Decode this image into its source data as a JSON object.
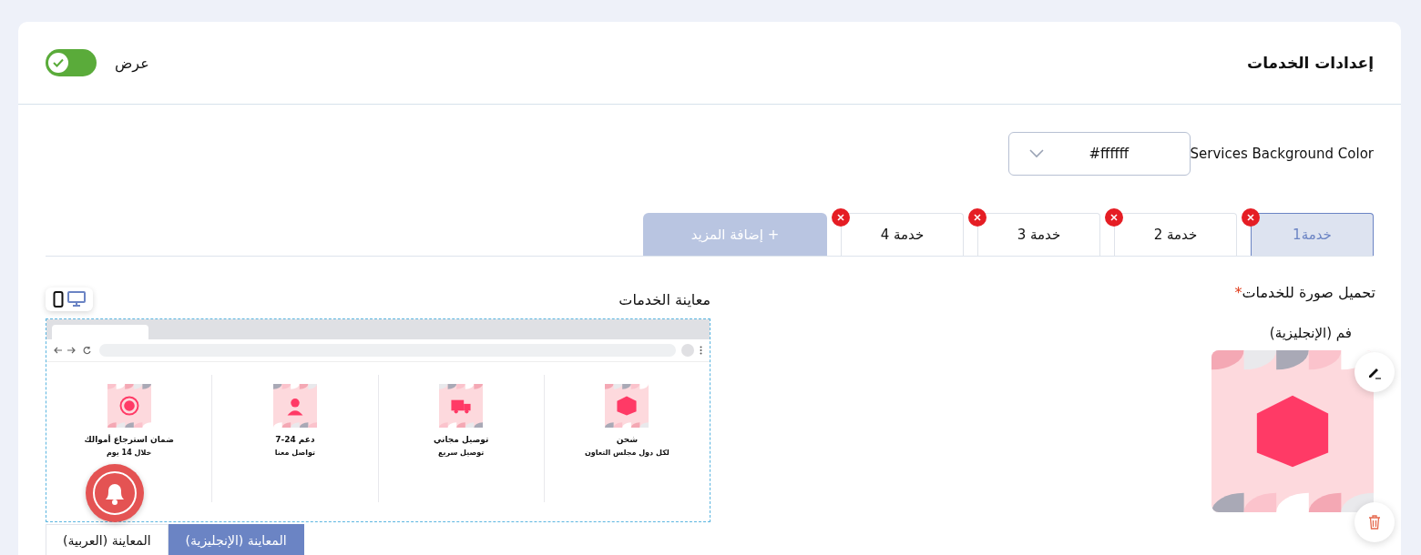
{
  "header": {
    "title": "إعدادات الخدمات",
    "display_toggle": {
      "label": "عرض",
      "on": true
    }
  },
  "background_color": {
    "label": "Services Background Color",
    "value": "#ffffff"
  },
  "service_tabs": [
    {
      "label": "خدمة1",
      "selected": true
    },
    {
      "label": "خدمة 2",
      "selected": false
    },
    {
      "label": "خدمة 3",
      "selected": false
    },
    {
      "label": "خدمة 4",
      "selected": false
    }
  ],
  "add_button": "+ إضافة المزيد",
  "upload": {
    "title": "تحميل صورة للخدمات",
    "required_mark": "*",
    "sublabel": "فم (الإنجليزية)"
  },
  "preview": {
    "title": "معاينة الخدمات",
    "devices": [
      {
        "kind": "mobile",
        "selected": false
      },
      {
        "kind": "desktop",
        "selected": true
      }
    ],
    "services": [
      {
        "title": "شحن",
        "subtitle": "لكل دول مجلس التعاون"
      },
      {
        "title": "توصيل مجاني",
        "subtitle": "توصيل سريع"
      },
      {
        "title": "دعم 24-7",
        "subtitle": "تواصل معنا"
      },
      {
        "title": "ضمان استرجاع أموالك",
        "subtitle": "خلال 14 يوم"
      }
    ],
    "language_tabs": [
      {
        "label": "المعاينة (الإنجليزية)",
        "selected": true
      },
      {
        "label": "المعاينة (العربية)",
        "selected": false
      }
    ]
  }
}
